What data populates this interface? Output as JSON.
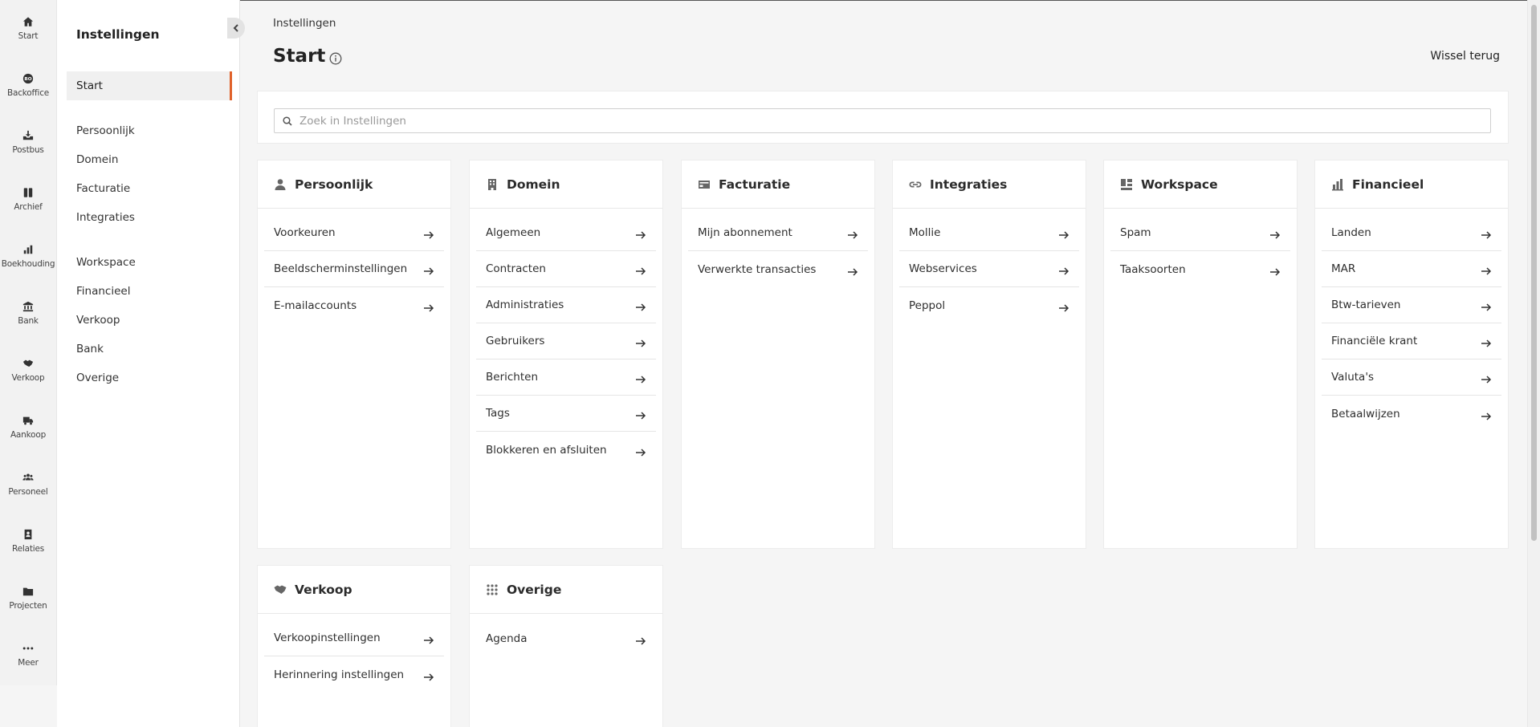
{
  "rail": [
    {
      "label": "Start",
      "icon": "home-icon"
    },
    {
      "label": "Backoffice",
      "icon": "backoffice-icon"
    },
    {
      "label": "Postbus",
      "icon": "inbox-icon"
    },
    {
      "label": "Archief",
      "icon": "archive-icon"
    },
    {
      "label": "Boekhouding",
      "icon": "bar-chart-icon"
    },
    {
      "label": "Bank",
      "icon": "bank-icon"
    },
    {
      "label": "Verkoop",
      "icon": "handshake-icon"
    },
    {
      "label": "Aankoop",
      "icon": "truck-icon"
    },
    {
      "label": "Personeel",
      "icon": "people-icon"
    },
    {
      "label": "Relaties",
      "icon": "contact-book-icon"
    },
    {
      "label": "Projecten",
      "icon": "folder-icon"
    },
    {
      "label": "Meer",
      "icon": "more-icon"
    }
  ],
  "sidebar": {
    "title": "Instellingen",
    "items": [
      "Start",
      "Persoonlijk",
      "Domein",
      "Facturatie",
      "Integraties",
      "Workspace",
      "Financieel",
      "Verkoop",
      "Bank",
      "Overige"
    ]
  },
  "header": {
    "breadcrumb": "Instellingen",
    "title": "Start",
    "switch_back": "Wissel terug"
  },
  "search": {
    "placeholder": "Zoek in Instellingen",
    "value": ""
  },
  "cards": [
    {
      "title": "Persoonlijk",
      "icon": "person-icon",
      "items": [
        "Voorkeuren",
        "Beeldscherminstellingen",
        "E-mailaccounts"
      ]
    },
    {
      "title": "Domein",
      "icon": "building-icon",
      "items": [
        "Algemeen",
        "Contracten",
        "Administraties",
        "Gebruikers",
        "Berichten",
        "Tags",
        "Blokkeren en afsluiten"
      ]
    },
    {
      "title": "Facturatie",
      "icon": "billing-icon",
      "items": [
        "Mijn abonnement",
        "Verwerkte transacties"
      ]
    },
    {
      "title": "Integraties",
      "icon": "link-icon",
      "items": [
        "Mollie",
        "Webservices",
        "Peppol"
      ]
    },
    {
      "title": "Workspace",
      "icon": "workspace-icon",
      "items": [
        "Spam",
        "Taaksoorten"
      ]
    },
    {
      "title": "Financieel",
      "icon": "bar-chart-icon",
      "items": [
        "Landen",
        "MAR",
        "Btw-tarieven",
        "Financiële krant",
        "Valuta's",
        "Betaalwijzen"
      ]
    },
    {
      "title": "Verkoop",
      "icon": "handshake-icon",
      "items": [
        "Verkoopinstellingen",
        "Herinnering instellingen"
      ]
    },
    {
      "title": "Overige",
      "icon": "grid-dots-icon",
      "items": [
        "Agenda"
      ]
    }
  ],
  "colors": {
    "accent": "#e0612a"
  }
}
